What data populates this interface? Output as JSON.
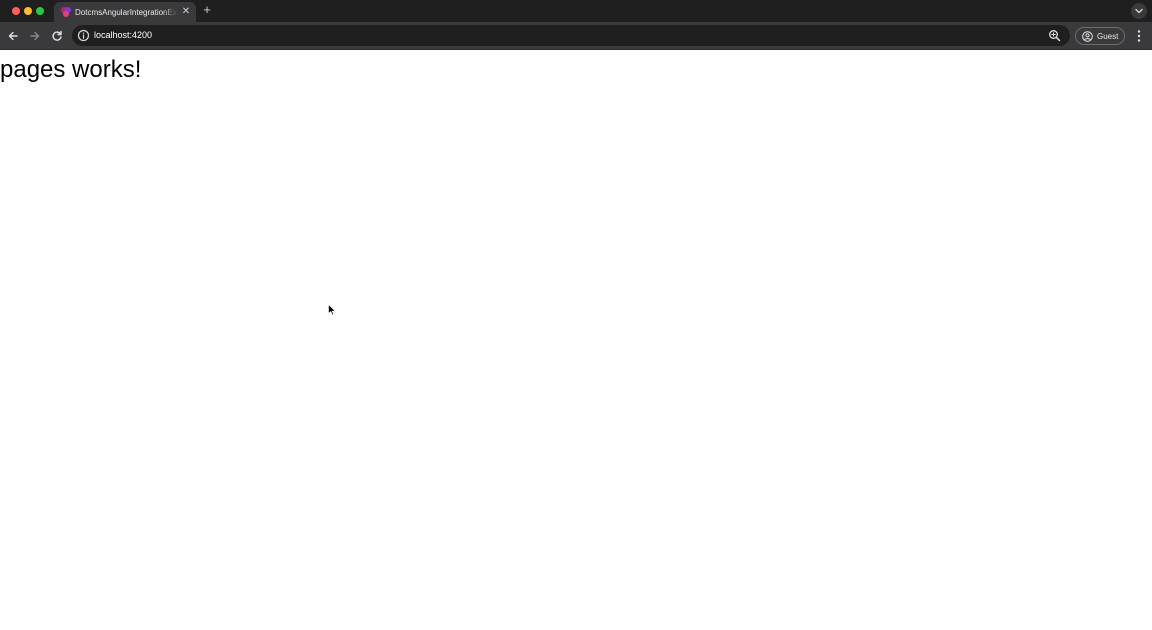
{
  "browser": {
    "tab": {
      "title": "DotcmsAngularIntegrationExample"
    },
    "address_bar": {
      "url": "localhost:4200"
    },
    "profile": {
      "label": "Guest"
    },
    "icons": {
      "back": "arrow-left-icon",
      "forward": "arrow-right-icon",
      "reload": "reload-icon",
      "site_info": "info-circle-icon",
      "zoom": "zoom-icon",
      "profile": "user-circle-icon",
      "menu": "kebab-menu-icon",
      "new_tab": "plus-icon",
      "tab_close": "close-icon"
    }
  },
  "page": {
    "heading": "pages works!"
  },
  "colors": {
    "tab_strip_bg": "#1f1f1f",
    "toolbar_bg": "#3a3a3c",
    "omnibox_bg": "#1f1f1f",
    "traffic_red": "#ff5f57",
    "traffic_yellow": "#febc2e",
    "traffic_green": "#28c840",
    "page_bg": "#ffffff",
    "page_text": "#000000"
  }
}
